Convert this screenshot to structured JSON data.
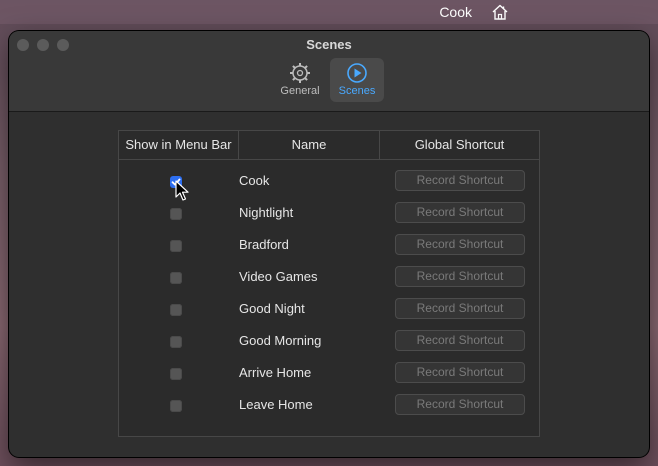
{
  "menubar": {
    "app_label": "Cook",
    "icon": "home-icon"
  },
  "window": {
    "title": "Scenes",
    "tabs": [
      {
        "label": "General",
        "icon": "gear-icon",
        "selected": false
      },
      {
        "label": "Scenes",
        "icon": "play-circle-icon",
        "selected": true
      }
    ]
  },
  "table": {
    "headers": {
      "show": "Show in Menu Bar",
      "name": "Name",
      "shortcut": "Global Shortcut"
    },
    "rows": [
      {
        "name": "Cook",
        "checked": true,
        "button": "Record Shortcut"
      },
      {
        "name": "Nightlight",
        "checked": false,
        "button": "Record Shortcut"
      },
      {
        "name": "Bradford",
        "checked": false,
        "button": "Record Shortcut"
      },
      {
        "name": "Video Games",
        "checked": false,
        "button": "Record Shortcut"
      },
      {
        "name": "Good Night",
        "checked": false,
        "button": "Record Shortcut"
      },
      {
        "name": "Good Morning",
        "checked": false,
        "button": "Record Shortcut"
      },
      {
        "name": "Arrive Home",
        "checked": false,
        "button": "Record Shortcut"
      },
      {
        "name": "Leave Home",
        "checked": false,
        "button": "Record Shortcut"
      }
    ]
  },
  "colors": {
    "accent": "#49a9ff",
    "checkbox_checked": "#2d6ef0",
    "window_bg": "#2f2f2f"
  }
}
